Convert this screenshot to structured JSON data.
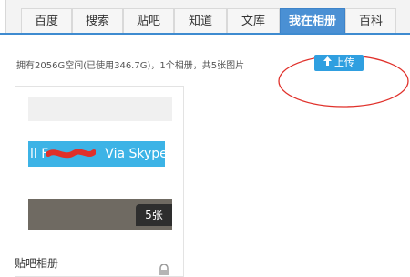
{
  "nav": {
    "tabs": [
      {
        "label": "百度",
        "active": false
      },
      {
        "label": "搜索",
        "active": false
      },
      {
        "label": "贴吧",
        "active": false
      },
      {
        "label": "知道",
        "active": false
      },
      {
        "label": "文库",
        "active": false
      },
      {
        "label": "我在相册",
        "active": true
      },
      {
        "label": "百科",
        "active": false
      }
    ]
  },
  "info": {
    "summary": "拥有2056G空间(已使用346.7G)，1个相册，共5张图片"
  },
  "upload": {
    "label": "上传",
    "icon": "upload-arrow-icon"
  },
  "album": {
    "name": "贴吧相册",
    "count_badge": "5张",
    "cover_text": "ll F",
    "cover_text_tail": "Via Skype",
    "lock_icon": "lock-icon"
  },
  "colors": {
    "nav_accent": "#3e8bd0",
    "upload_button": "#2f9fe0",
    "skype_bar": "#3cb3e6",
    "annotation_red": "#e0302a"
  }
}
